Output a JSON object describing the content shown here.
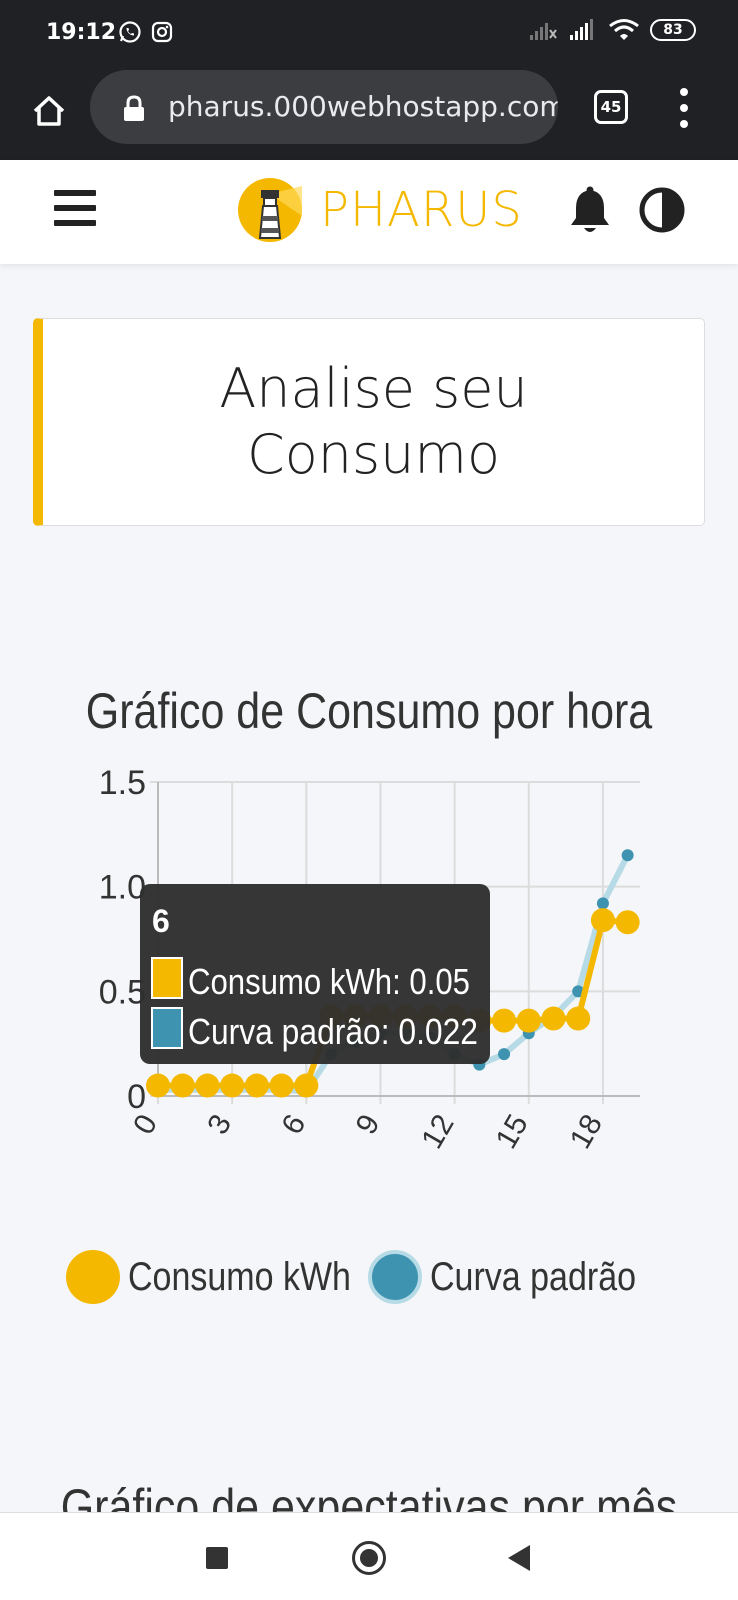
{
  "status_bar": {
    "time": "19:12",
    "battery": "83"
  },
  "browser": {
    "url": "pharus.000webhostapp.com",
    "tab_count": "45"
  },
  "header": {
    "logo_text": "PHARUS"
  },
  "title_card": {
    "line1": "Analise seu",
    "line2": "Consumo"
  },
  "colors": {
    "accent": "#f5b800",
    "series2": "#3d93b0"
  },
  "chart_data": {
    "type": "line",
    "title": "Gráfico de Consumo por hora",
    "x": [
      0,
      1,
      2,
      3,
      4,
      5,
      6,
      7,
      8,
      9,
      10,
      11,
      12,
      13,
      14,
      15,
      16,
      17,
      18,
      19
    ],
    "x_ticks": [
      "0",
      "3",
      "6",
      "9",
      "12",
      "15",
      "18"
    ],
    "y_ticks": [
      "0",
      "0.5",
      "1.0",
      "1.5"
    ],
    "ylim": [
      0,
      1.5
    ],
    "series": [
      {
        "name": "Consumo kWh",
        "color": "#f5b800",
        "values": [
          0.05,
          0.05,
          0.05,
          0.05,
          0.05,
          0.05,
          0.05,
          0.38,
          0.38,
          0.38,
          0.38,
          0.38,
          0.38,
          0.36,
          0.36,
          0.36,
          0.37,
          0.37,
          0.84,
          0.83
        ]
      },
      {
        "name": "Curva padrão",
        "color": "#3d93b0",
        "values": [
          0.03,
          0.03,
          0.03,
          0.03,
          0.03,
          0.03,
          0.022,
          0.2,
          0.26,
          0.3,
          0.3,
          0.28,
          0.2,
          0.15,
          0.2,
          0.3,
          0.38,
          0.5,
          0.92,
          1.15
        ]
      }
    ],
    "tooltip": {
      "title": "6",
      "line1": "Consumo kWh: 0.05",
      "line2": "Curva padrão: 0.022"
    },
    "legend_position": "bottom"
  },
  "section2": {
    "title": "Gráfico de expectativas por mês"
  }
}
